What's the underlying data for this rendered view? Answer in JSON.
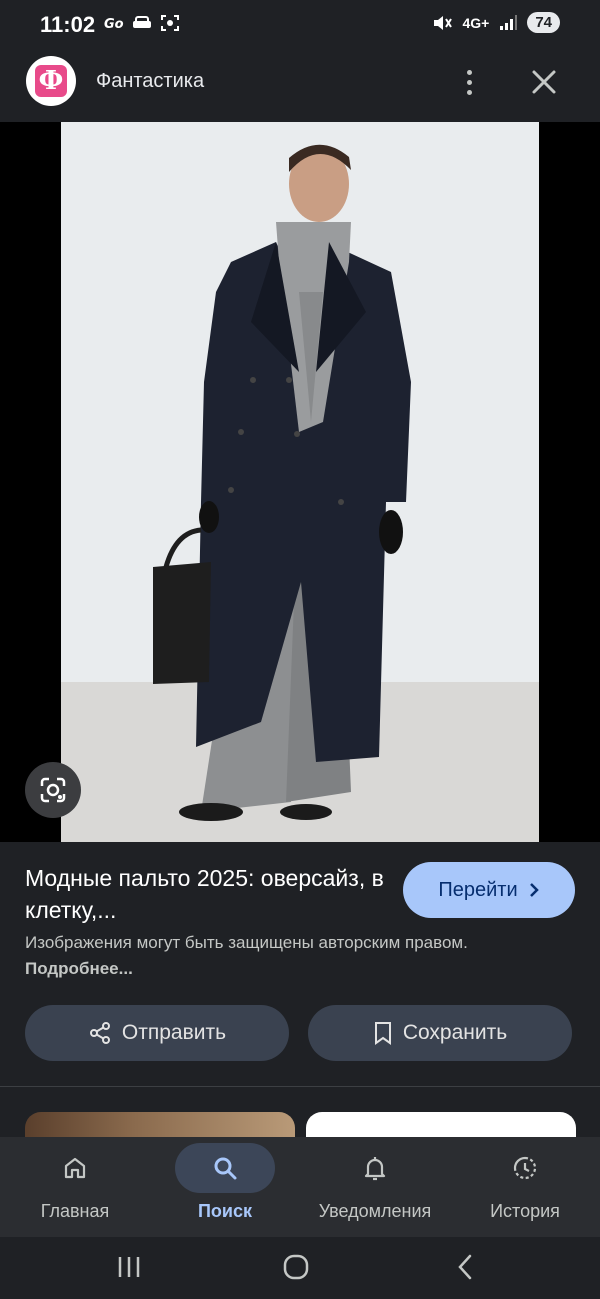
{
  "status_bar": {
    "time": "11:02",
    "network": "4G+",
    "battery": "74"
  },
  "header": {
    "site_logo_letter": "Ф",
    "site_name": "Фантастика"
  },
  "result": {
    "title": "Модные пальто 2025: оверсайз, в клетку,...",
    "go_label": "Перейти",
    "notice_text": "Изображения могут быть защищены авторским правом. ",
    "notice_link": "Подробнее...",
    "share_label": "Отправить",
    "save_label": "Сохранить"
  },
  "bottom_nav": {
    "items": [
      {
        "label": "Главная",
        "icon": "home-icon",
        "active": false
      },
      {
        "label": "Поиск",
        "icon": "search-icon",
        "active": true
      },
      {
        "label": "Уведомления",
        "icon": "bell-icon",
        "active": false
      },
      {
        "label": "История",
        "icon": "history-icon",
        "active": false
      }
    ]
  },
  "colors": {
    "background": "#1f2125",
    "accent": "#a8c7fa",
    "button_bg": "#3a4250",
    "nav_bg": "#2b2d31"
  }
}
